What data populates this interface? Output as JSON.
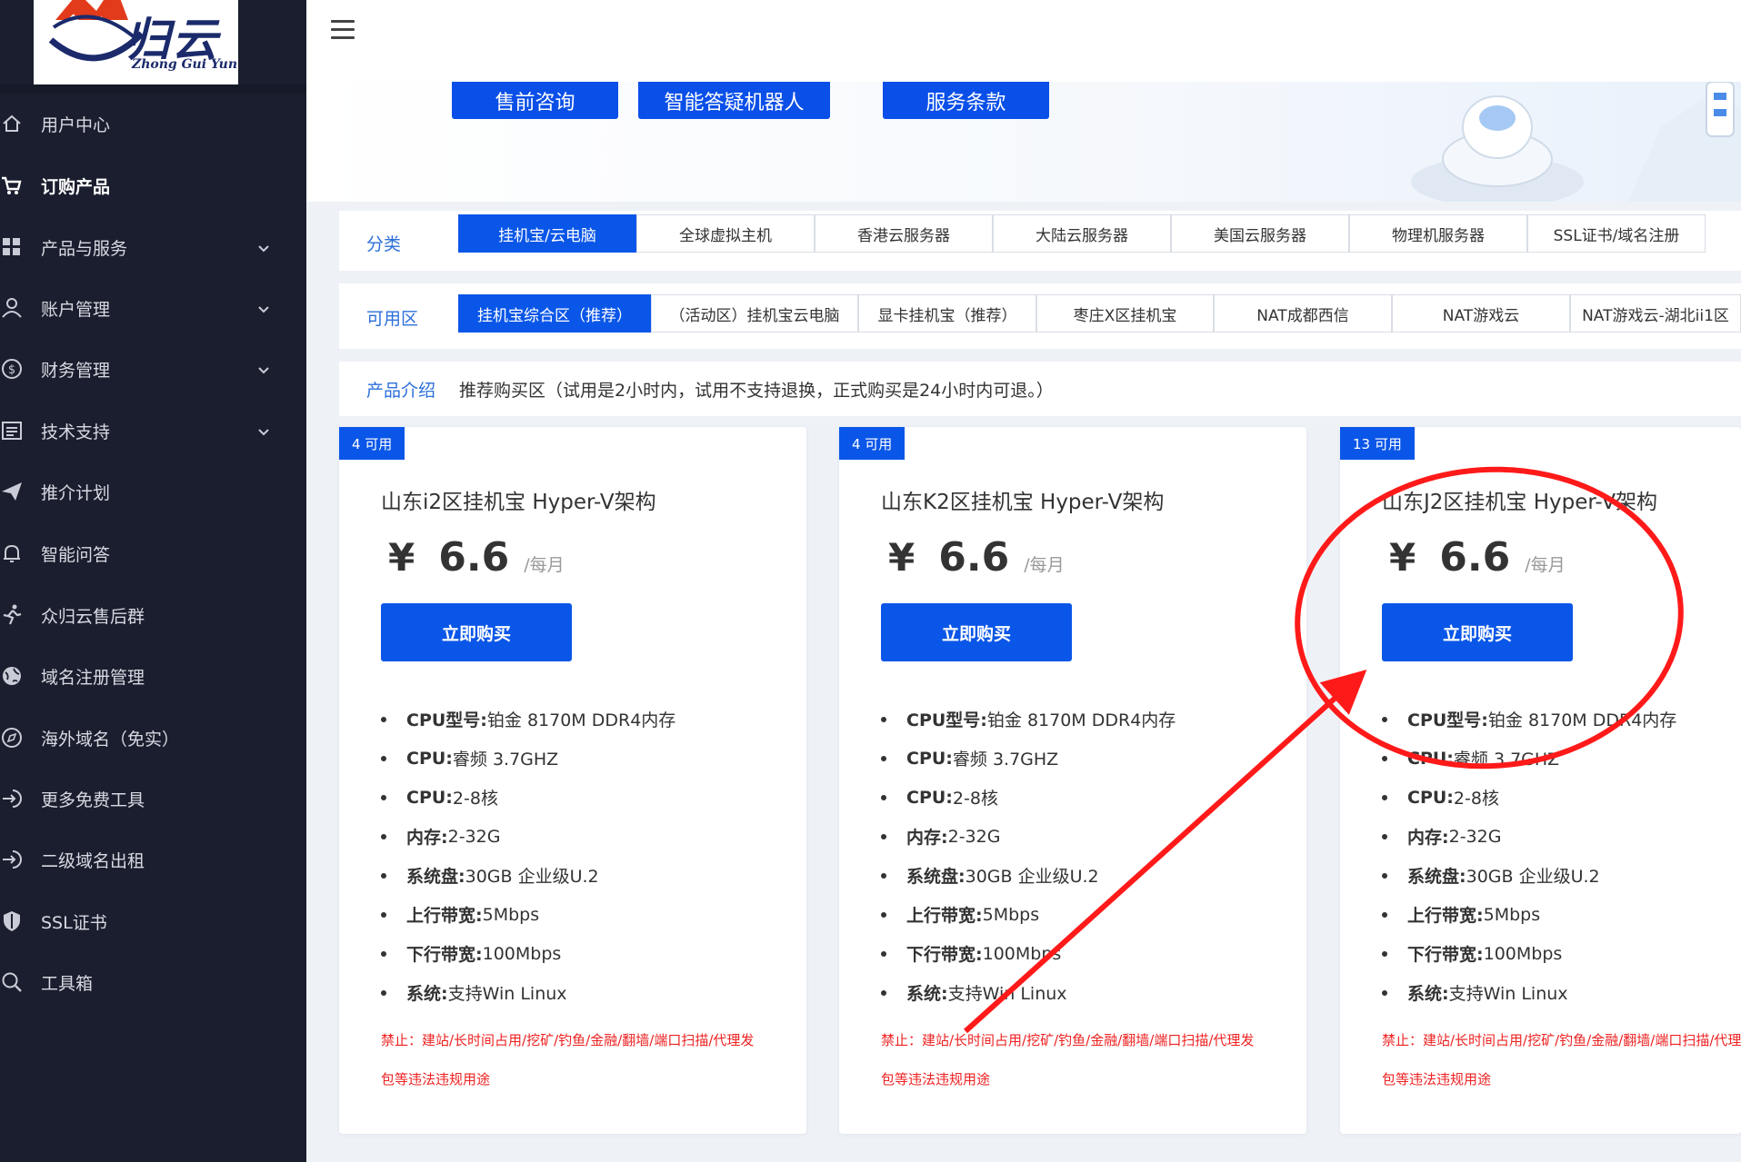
{
  "brand": {
    "logo_cn": "归云",
    "logo_en": "Zhong Gui Yun"
  },
  "sidebar": {
    "items": [
      {
        "label": "用户中心",
        "icon": "home-icon",
        "expandable": false,
        "active": false
      },
      {
        "label": "订购产品",
        "icon": "cart-icon",
        "expandable": false,
        "active": true
      },
      {
        "label": "产品与服务",
        "icon": "grid-icon",
        "expandable": true,
        "active": false
      },
      {
        "label": "账户管理",
        "icon": "user-icon",
        "expandable": true,
        "active": false
      },
      {
        "label": "财务管理",
        "icon": "dollar-icon",
        "expandable": true,
        "active": false
      },
      {
        "label": "技术支持",
        "icon": "list-icon",
        "expandable": true,
        "active": false
      },
      {
        "label": "推介计划",
        "icon": "send-icon",
        "expandable": false,
        "active": false
      },
      {
        "label": "智能问答",
        "icon": "bell-icon",
        "expandable": false,
        "active": false
      },
      {
        "label": "众归云售后群",
        "icon": "runner-icon",
        "expandable": false,
        "active": false
      },
      {
        "label": "域名注册管理",
        "icon": "globe-icon",
        "expandable": false,
        "active": false
      },
      {
        "label": "海外域名（免实）",
        "icon": "compass-icon",
        "expandable": false,
        "active": false
      },
      {
        "label": "更多免费工具",
        "icon": "login-icon",
        "expandable": false,
        "active": false
      },
      {
        "label": "二级域名出租",
        "icon": "login-icon",
        "expandable": false,
        "active": false
      },
      {
        "label": "SSL证书",
        "icon": "shield-icon",
        "expandable": false,
        "active": false
      },
      {
        "label": "工具箱",
        "icon": "search-icon",
        "expandable": false,
        "active": false
      }
    ]
  },
  "banner": {
    "buttons": [
      "售前咨询",
      "智能答疑机器人",
      "服务条款"
    ]
  },
  "category": {
    "label": "分类",
    "tabs": [
      "挂机宝/云电脑",
      "全球虚拟主机",
      "香港云服务器",
      "大陆云服务器",
      "美国云服务器",
      "物理机服务器",
      "SSL证书/域名注册"
    ],
    "selected": 0
  },
  "zone": {
    "label": "可用区",
    "tabs": [
      "挂机宝综合区（推荐）",
      "（活动区）挂机宝云电脑",
      "显卡挂机宝（推荐）",
      "枣庄X区挂机宝",
      "NAT成都西信",
      "NAT游戏云",
      "NAT游戏云-湖北ii1区"
    ],
    "selected": 0
  },
  "intro": {
    "label": "产品介绍",
    "text": "推荐购买区（试用是2小时内，试用不支持退换，正式购买是24小时内可退。）"
  },
  "products": [
    {
      "badge": "4 可用",
      "title": "山东i2区挂机宝 Hyper-V架构",
      "currency": "¥",
      "price": "6.6",
      "unit": "/每月",
      "buy_label": "立即购买",
      "specs": [
        {
          "key": "CPU型号:",
          "value": " 铂金 8170M DDR4内存"
        },
        {
          "key": "CPU:",
          "value": "睿频 3.7GHZ"
        },
        {
          "key": "CPU:",
          "value": " 2-8核"
        },
        {
          "key": "内存:",
          "value": " 2-32G"
        },
        {
          "key": "系统盘:",
          "value": " 30GB 企业级U.2"
        },
        {
          "key": "上行带宽:",
          "value": "5Mbps"
        },
        {
          "key": "下行带宽:",
          "value": "100Mbps"
        },
        {
          "key": "系统:",
          "value": " 支持Win Linux"
        }
      ],
      "ban_line1": "禁止：建站/长时间占用/挖矿/钓鱼/金融/翻墙/端口扫描/代理发",
      "ban_line2": "包等违法违规用途"
    },
    {
      "badge": "4 可用",
      "title": "山东K2区挂机宝 Hyper-V架构",
      "currency": "¥",
      "price": "6.6",
      "unit": "/每月",
      "buy_label": "立即购买",
      "specs": [
        {
          "key": "CPU型号:",
          "value": " 铂金 8170M DDR4内存"
        },
        {
          "key": "CPU:",
          "value": "睿频 3.7GHZ"
        },
        {
          "key": "CPU:",
          "value": " 2-8核"
        },
        {
          "key": "内存:",
          "value": " 2-32G"
        },
        {
          "key": "系统盘:",
          "value": " 30GB 企业级U.2"
        },
        {
          "key": "上行带宽:",
          "value": "5Mbps"
        },
        {
          "key": "下行带宽:",
          "value": "100Mbps"
        },
        {
          "key": "系统:",
          "value": " 支持Win Linux"
        }
      ],
      "ban_line1": "禁止：建站/长时间占用/挖矿/钓鱼/金融/翻墙/端口扫描/代理发",
      "ban_line2": "包等违法违规用途"
    },
    {
      "badge": "13 可用",
      "title": "山东J2区挂机宝 Hyper-V架构",
      "currency": "¥",
      "price": "6.6",
      "unit": "/每月",
      "buy_label": "立即购买",
      "specs": [
        {
          "key": "CPU型号:",
          "value": " 铂金 8170M DDR4内存"
        },
        {
          "key": "CPU:",
          "value": "睿频 3.7GHZ"
        },
        {
          "key": "CPU:",
          "value": " 2-8核"
        },
        {
          "key": "内存:",
          "value": " 2-32G"
        },
        {
          "key": "系统盘:",
          "value": " 30GB 企业级U.2"
        },
        {
          "key": "上行带宽:",
          "value": "5Mbps"
        },
        {
          "key": "下行带宽:",
          "value": "100Mbps"
        },
        {
          "key": "系统:",
          "value": " 支持Win Linux"
        }
      ],
      "ban_line1": "禁止：建站/长时间占用/挖矿/钓鱼/金融/翻墙/端口扫描/代理发",
      "ban_line2": "包等违法违规用途"
    }
  ],
  "colors": {
    "primary": "#0a56e8",
    "sidebar_bg": "#1b1e2e",
    "ban_red": "#ee2222",
    "annotation_red": "#ff1a1a"
  }
}
